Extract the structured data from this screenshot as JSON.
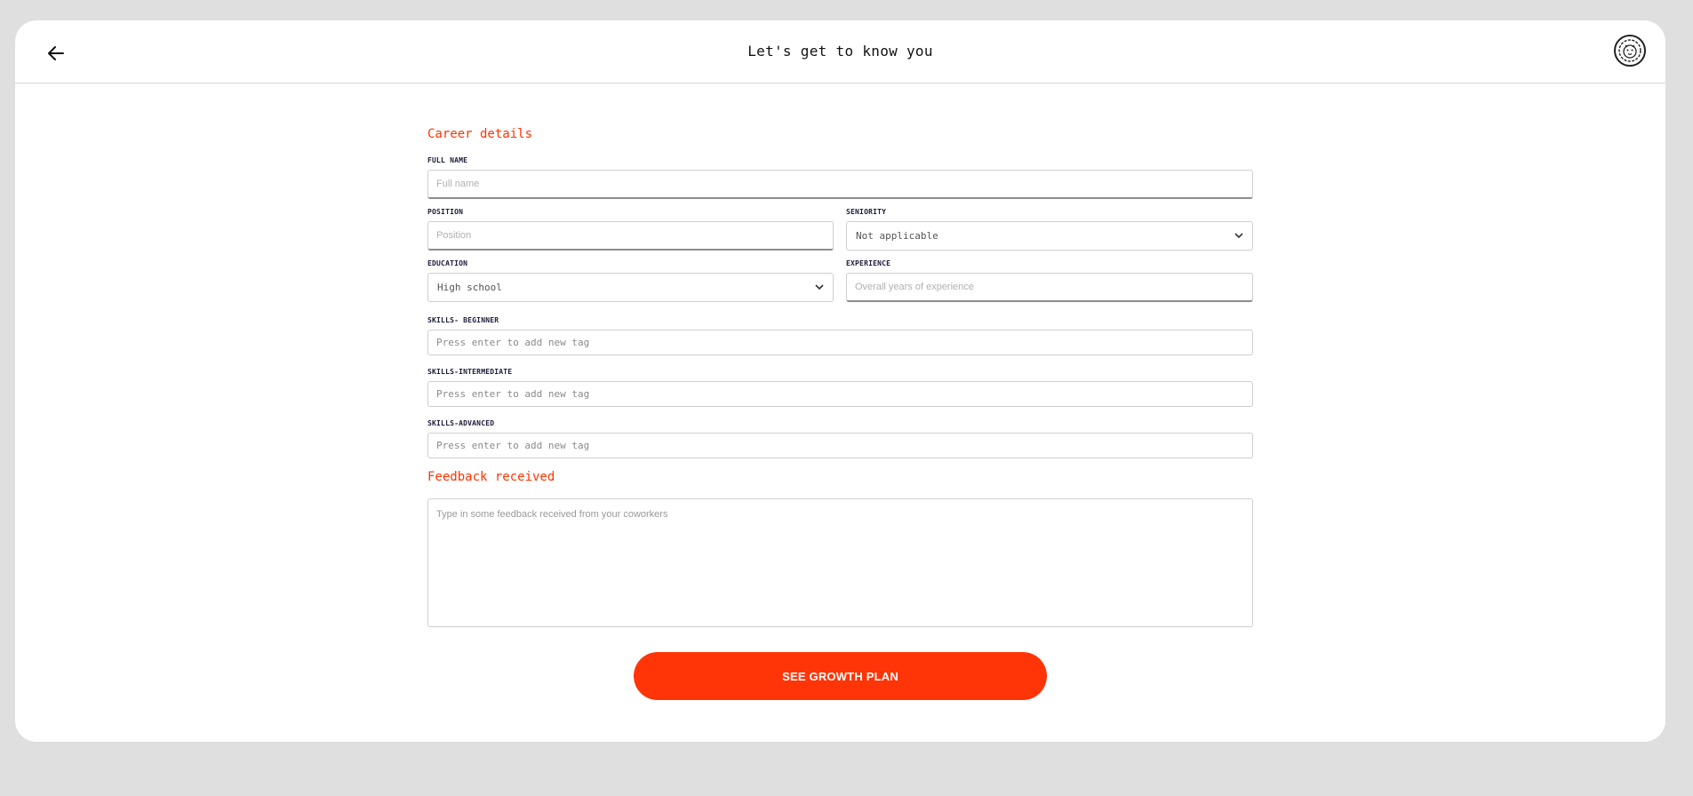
{
  "header": {
    "title": "Let's get to know you",
    "back_icon": "arrow-left-icon",
    "avatar_icon": "lion-logo-icon"
  },
  "career": {
    "section_title": "Career details",
    "full_name": {
      "label": "FULL NAME",
      "placeholder": "Full name",
      "value": ""
    },
    "position": {
      "label": "POSITION",
      "placeholder": "Position",
      "value": ""
    },
    "seniority": {
      "label": "SENIORITY",
      "selected": "Not applicable"
    },
    "education": {
      "label": "EDUCATION",
      "selected": "High school"
    },
    "experience": {
      "label": "EXPERIENCE",
      "placeholder": "Overall years of experience",
      "value": ""
    },
    "skills_beginner": {
      "label": "SKILLS- BEGINNER",
      "placeholder": "Press enter to add new tag"
    },
    "skills_intermediate": {
      "label": "SKILLS-INTERMEDIATE",
      "placeholder": "Press enter to add new tag"
    },
    "skills_advanced": {
      "label": "SKILLS-ADVANCED",
      "placeholder": "Press enter to add new tag"
    }
  },
  "feedback": {
    "section_title": "Feedback received",
    "placeholder": "Type in some feedback received from your coworkers"
  },
  "submit_label": "SEE GROWTH PLAN",
  "colors": {
    "accent": "#ff3407",
    "background": "#dfdfdf",
    "card": "#ffffff"
  }
}
